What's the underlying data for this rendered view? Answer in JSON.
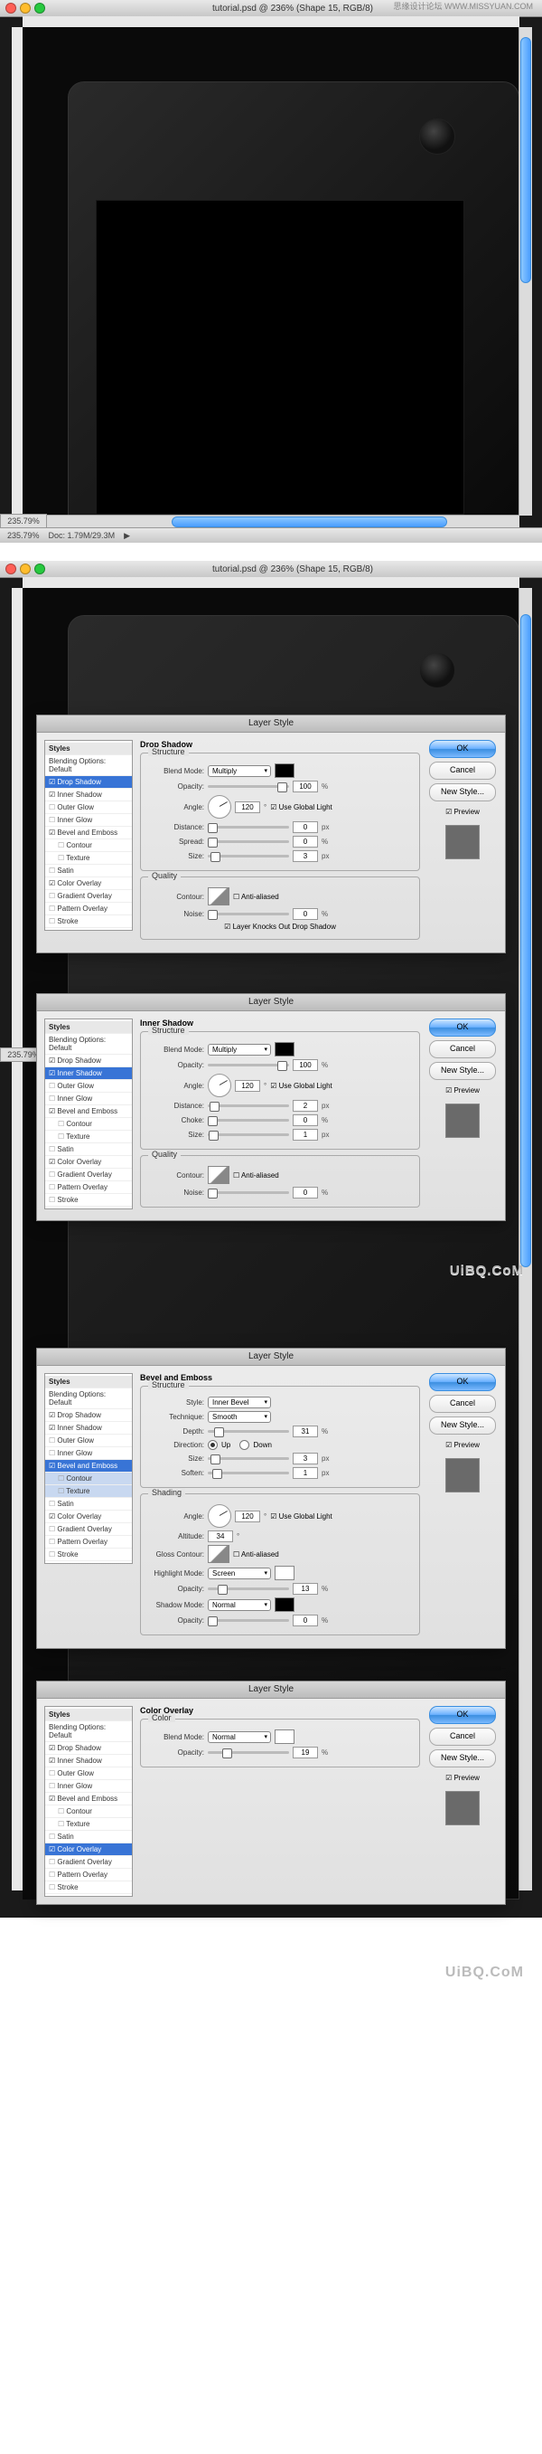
{
  "watermark_top": "思缘设计论坛  WWW.MISSYUAN.COM",
  "watermark_bottom": "UiBQ.CoM",
  "window": {
    "title": "tutorial.psd @ 236% (Shape 15, RGB/8)",
    "zoom": "235.79%",
    "doc": "Doc: 1.79M/29.3M"
  },
  "dialog_title": "Layer Style",
  "buttons": {
    "ok": "OK",
    "cancel": "Cancel",
    "new_style": "New Style...",
    "preview": "Preview"
  },
  "styles_list": {
    "header": "Styles",
    "blending": "Blending Options: Default",
    "drop_shadow": "Drop Shadow",
    "inner_shadow": "Inner Shadow",
    "outer_glow": "Outer Glow",
    "inner_glow": "Inner Glow",
    "bevel": "Bevel and Emboss",
    "contour": "Contour",
    "texture": "Texture",
    "satin": "Satin",
    "color_overlay": "Color Overlay",
    "gradient_overlay": "Gradient Overlay",
    "pattern_overlay": "Pattern Overlay",
    "stroke": "Stroke"
  },
  "labels": {
    "blend_mode": "Blend Mode:",
    "opacity": "Opacity:",
    "angle": "Angle:",
    "distance": "Distance:",
    "spread": "Spread:",
    "size": "Size:",
    "choke": "Choke:",
    "contour": "Contour:",
    "noise": "Noise:",
    "anti_aliased": "Anti-aliased",
    "use_global": "Use Global Light",
    "knockout": "Layer Knocks Out Drop Shadow",
    "style": "Style:",
    "technique": "Technique:",
    "depth": "Depth:",
    "direction": "Direction:",
    "up": "Up",
    "down": "Down",
    "soften": "Soften:",
    "altitude": "Altitude:",
    "gloss_contour": "Gloss Contour:",
    "highlight_mode": "Highlight Mode:",
    "shadow_mode": "Shadow Mode:"
  },
  "sections": {
    "drop_shadow": "Drop Shadow",
    "inner_shadow": "Inner Shadow",
    "bevel": "Bevel and Emboss",
    "color_overlay": "Color Overlay",
    "structure": "Structure",
    "quality": "Quality",
    "shading": "Shading",
    "color": "Color"
  },
  "values": {
    "multiply": "Multiply",
    "normal": "Normal",
    "screen": "Screen",
    "smooth": "Smooth",
    "inner_bevel": "Inner Bevel",
    "pct": "%",
    "px": "px",
    "deg": "°"
  },
  "drop_shadow": {
    "opacity": "100",
    "angle": "120",
    "distance": "0",
    "spread": "0",
    "size": "3",
    "noise": "0"
  },
  "inner_shadow": {
    "opacity": "100",
    "angle": "120",
    "distance": "2",
    "choke": "0",
    "size": "1",
    "noise": "0"
  },
  "bevel": {
    "depth": "31",
    "size": "3",
    "soften": "1",
    "angle": "120",
    "altitude": "34",
    "hi_opacity": "13",
    "sh_opacity": "0"
  },
  "color_overlay": {
    "opacity": "19"
  }
}
